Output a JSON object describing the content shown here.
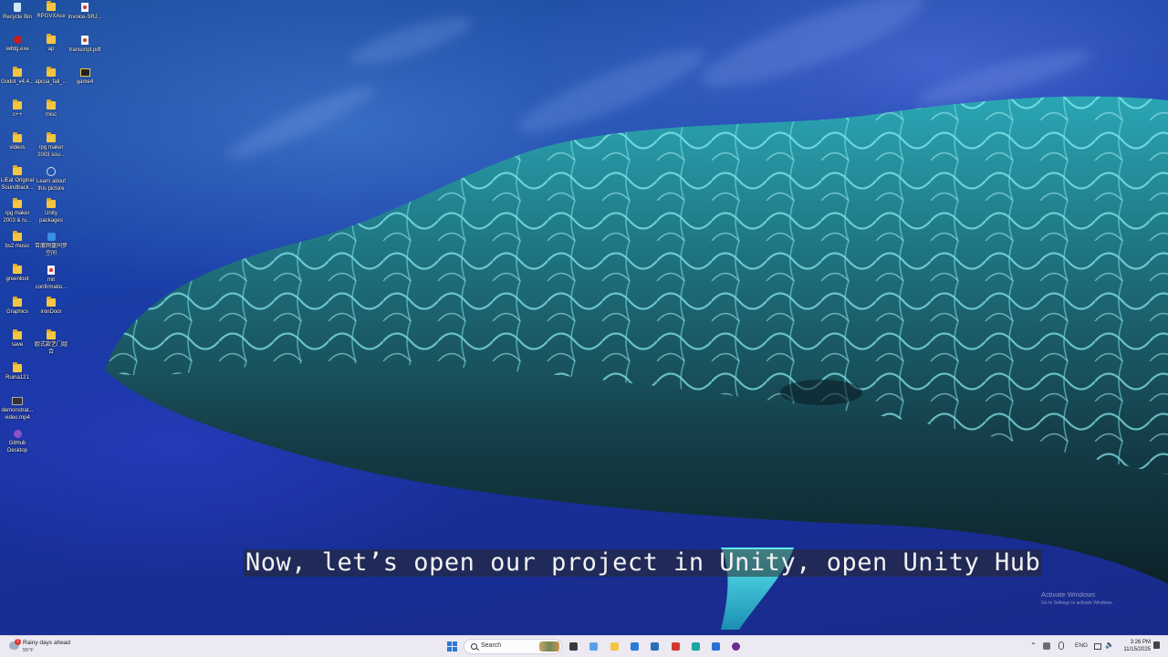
{
  "desktop_icons": [
    {
      "label": "Recycle Bin",
      "icon": "recycle-bin-icon"
    },
    {
      "label": "RPGVXAce",
      "icon": "folder-icon"
    },
    {
      "label": "Invoice-SRJ...",
      "icon": "pdf-icon"
    },
    {
      "label": "iwbtg.exe",
      "icon": "exe-icon"
    },
    {
      "label": "ap",
      "icon": "folder-icon"
    },
    {
      "label": "transcript.pdf",
      "icon": "pdf-icon"
    },
    {
      "label": "Godot_v4.4...",
      "icon": "folder-icon"
    },
    {
      "label": "apcsa_fall_...",
      "icon": "folder-icon"
    },
    {
      "label": "game4",
      "icon": "game-icon"
    },
    {
      "label": "c++",
      "icon": "folder-icon"
    },
    {
      "label": "misc",
      "icon": "folder-icon"
    },
    {
      "label": "videos",
      "icon": "folder-icon"
    },
    {
      "label": "rpg maker 2003 sou...",
      "icon": "folder-icon"
    },
    {
      "label": "LiEat Original Soundtrack...",
      "icon": "folder-icon"
    },
    {
      "label": "Learn about this picture",
      "icon": "info-icon"
    },
    {
      "label": "rpg maker 2003 & ru...",
      "icon": "folder-icon"
    },
    {
      "label": "Unity packages",
      "icon": "folder-icon"
    },
    {
      "label": "bs2 music",
      "icon": "folder-icon"
    },
    {
      "label": "百度网盘同步空间",
      "icon": "baidu-icon"
    },
    {
      "label": "greenloot",
      "icon": "folder-icon"
    },
    {
      "label": "mit confirmatio...",
      "icon": "pdf-icon"
    },
    {
      "label": "Graphics",
      "icon": "folder-icon"
    },
    {
      "label": "ironDoor",
      "icon": "folder-icon"
    },
    {
      "label": "save",
      "icon": "folder-icon"
    },
    {
      "label": "欧式款艺门组合",
      "icon": "folder-icon"
    },
    {
      "label": "Ruina121",
      "icon": "folder-icon"
    },
    {
      "label": "demonstrat... video.mp4",
      "icon": "video-icon"
    },
    {
      "label": "GitHub Desktop",
      "icon": "github-icon"
    }
  ],
  "subtitle": "Now, let’s open our project in Unity, open Unity Hub",
  "watermark": {
    "title": "Activate Windows",
    "subtitle": "Go to Settings to activate Windows."
  },
  "taskbar": {
    "weather": {
      "text": "Rainy days ahead",
      "temp": "55°F",
      "badge": "1"
    },
    "search_placeholder": "Search",
    "pinned_apps": [
      "file-explorer-icon",
      "copilot-icon",
      "folder-icon",
      "store-icon",
      "vs-code-icon",
      "office-icon",
      "edge-icon",
      "snipping-tool-icon",
      "obs-icon"
    ],
    "tray": {
      "language": "ENG"
    },
    "clock": {
      "time": "3:26 PM",
      "date": "11/15/2025"
    }
  },
  "colors": {
    "taskbar_bg": "#ece9f2",
    "ocean_deep": "#1a2a8c",
    "whale_highlight": "#38d6e0",
    "accent_blue": "#2a78d6"
  }
}
